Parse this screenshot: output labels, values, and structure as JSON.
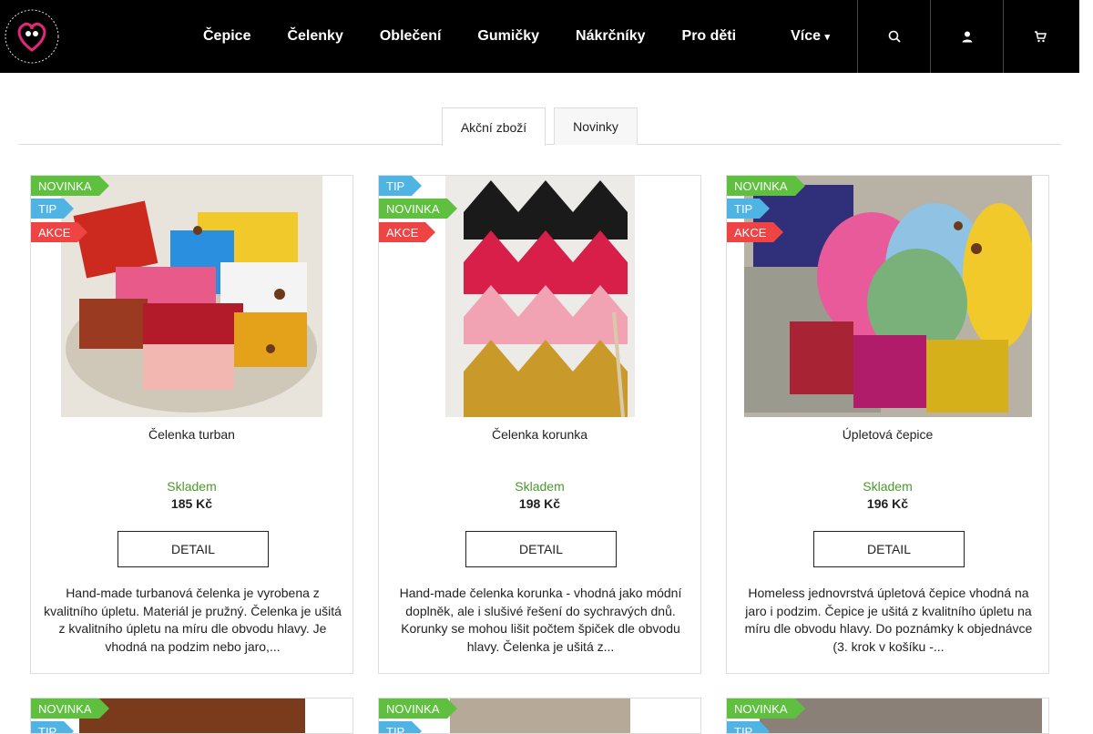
{
  "nav": {
    "items": [
      "Čepice",
      "Čelenky",
      "Oblečení",
      "Gumičky",
      "Nákrčníky",
      "Pro děti"
    ],
    "more_label": "Více"
  },
  "icons": [
    "search-icon",
    "user-icon",
    "cart-icon"
  ],
  "tabs": {
    "sale": "Akční zboží",
    "new": "Novinky"
  },
  "flags": {
    "new": "NOVINKA",
    "tip": "TIP",
    "sale": "AKCE"
  },
  "products": [
    {
      "title": "Čelenka turban",
      "stock": "Skladem",
      "price": "185 Kč",
      "detail_label": "DETAIL",
      "description": "Hand-made turbanová čelenka je vyrobena z kvalitního úpletu. Materiál je pružný. Čelenka je ušitá z kvalitního úpletu na míru dle obvodu hlavy. Je vhodná na podzim nebo jaro,...",
      "flags": [
        "NOVINKA",
        "TIP",
        "AKCE"
      ]
    },
    {
      "title": "Čelenka korunka",
      "stock": "Skladem",
      "price": "198 Kč",
      "detail_label": "DETAIL",
      "description": "Hand-made čelenka korunka - vhodná jako módní doplněk, ale i slušivé řešení do sychravých dnů. Korunky se mohou lišit počtem špiček dle obvodu hlavy. Čelenka je ušitá z...",
      "flags": [
        "TIP",
        "NOVINKA",
        "AKCE"
      ]
    },
    {
      "title": "Úpletová čepice",
      "stock": "Skladem",
      "price": "196 Kč",
      "detail_label": "DETAIL",
      "description": "Homeless jednovrstvá úpletová čepice vhodná na jaro i podzim. Čepice je ušitá z kvalitního úpletu na míru dle obvodu hlavy. Do poznámky k objednávce (3. krok v košíku -...",
      "flags": [
        "NOVINKA",
        "TIP",
        "AKCE"
      ]
    }
  ],
  "second_row_flags": [
    "NOVINKA",
    "NOVINKA",
    "NOVINKA"
  ],
  "colors": {
    "new": "#5fbf3e",
    "tip": "#4fb3e3",
    "sale": "#ee4444",
    "stock": "#4a9a2a"
  }
}
